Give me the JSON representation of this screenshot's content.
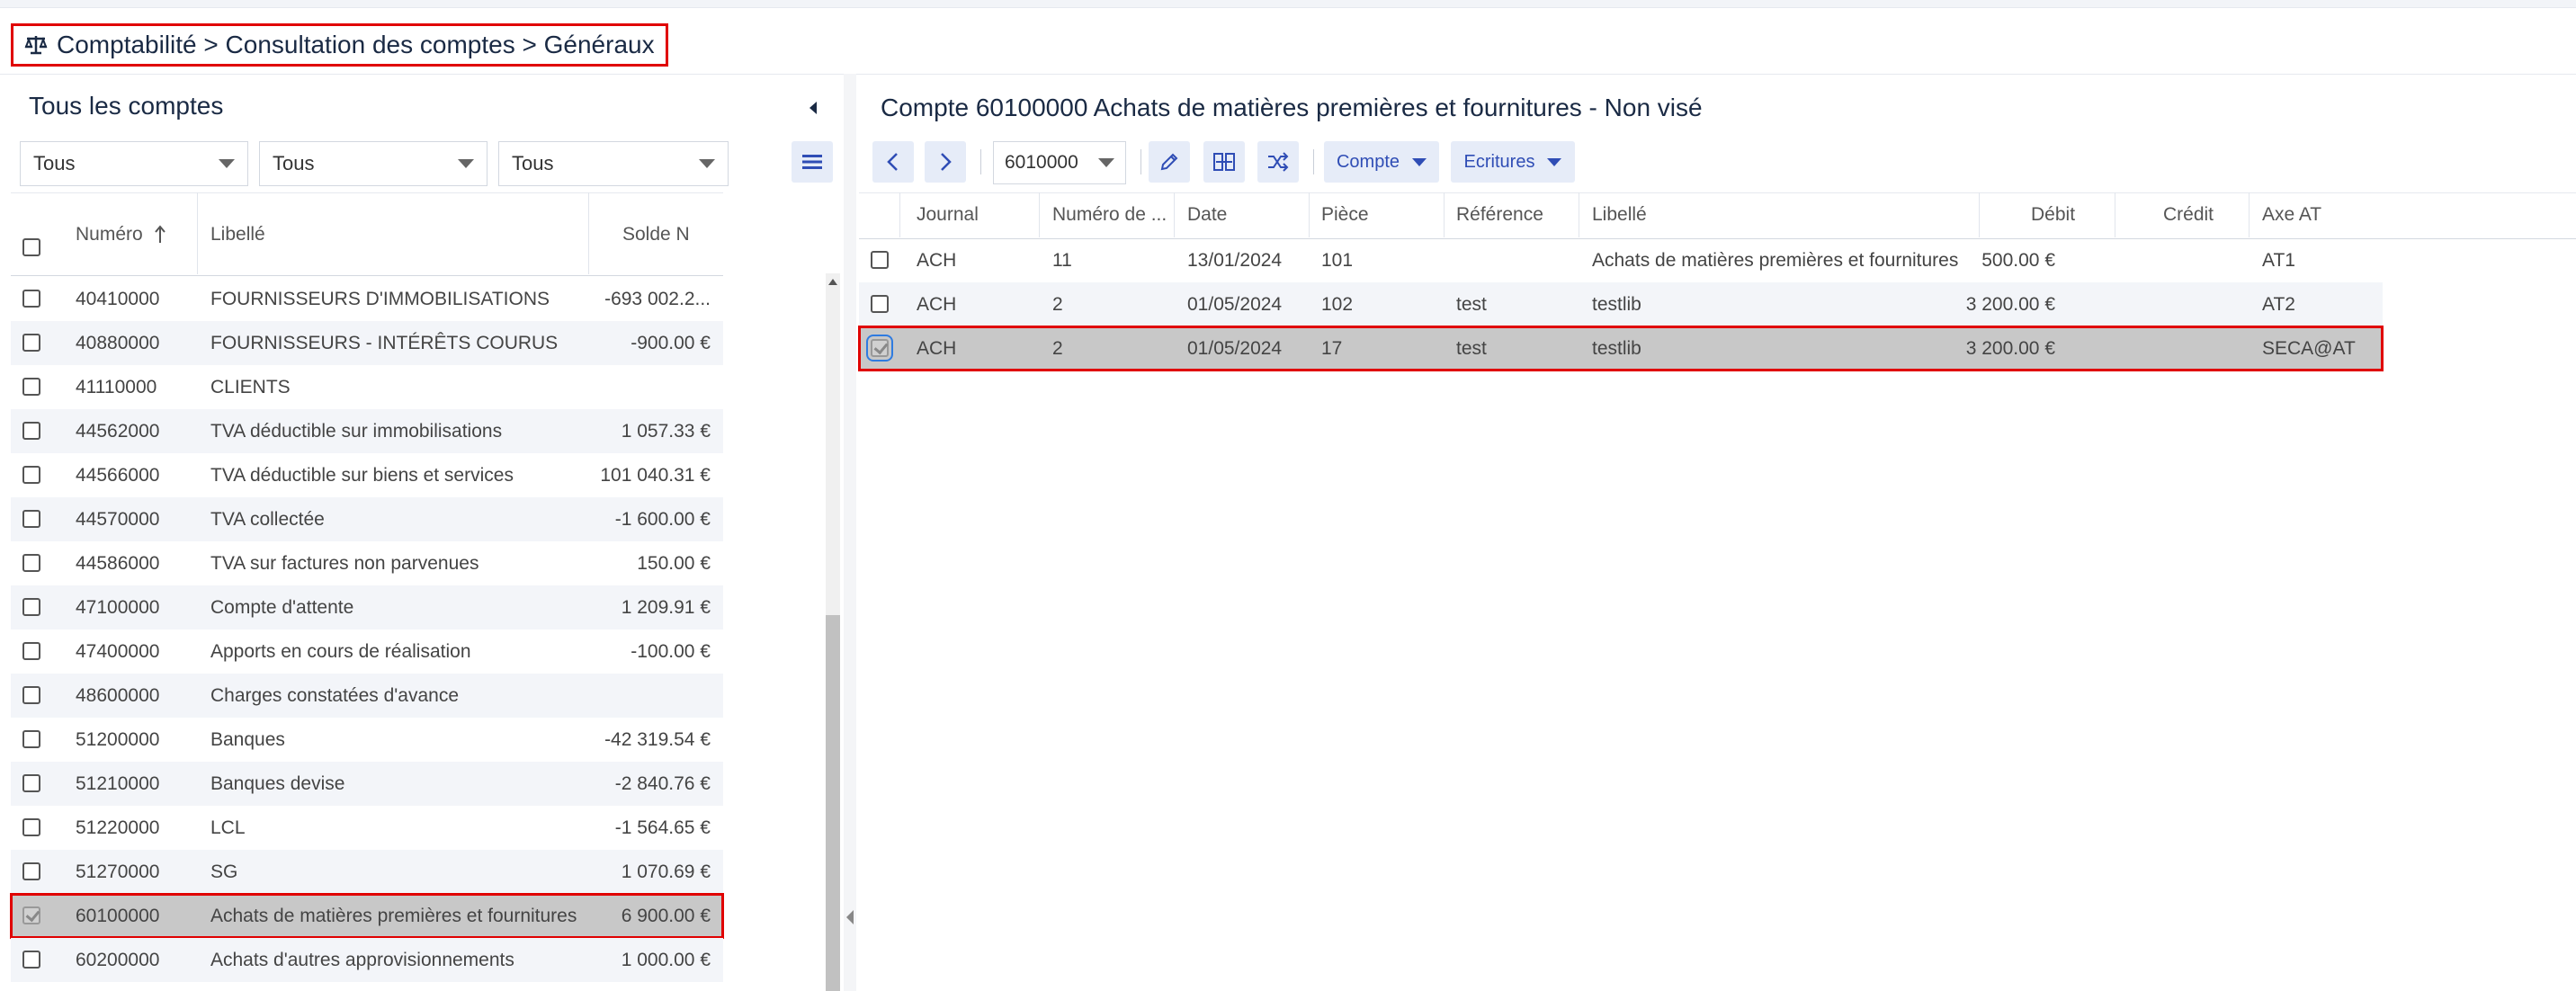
{
  "breadcrumb": "Comptabilité > Consultation des comptes > Généraux",
  "left": {
    "title": "Tous les comptes",
    "filters": [
      "Tous",
      "Tous",
      "Tous"
    ],
    "columns": {
      "numero": "Numéro",
      "libelle": "Libellé",
      "solde": "Solde N"
    },
    "rows": [
      {
        "num": "40410000",
        "lib": "FOURNISSEURS D'IMMOBILISATIONS",
        "solde": "-693 002.2..."
      },
      {
        "num": "40880000",
        "lib": "FOURNISSEURS - INTÉRÊTS COURUS",
        "solde": "-900.00 €"
      },
      {
        "num": "41110000",
        "lib": "CLIENTS",
        "solde": ""
      },
      {
        "num": "44562000",
        "lib": "TVA déductible sur immobilisations",
        "solde": "1 057.33 €"
      },
      {
        "num": "44566000",
        "lib": "TVA déductible sur biens et services",
        "solde": "101 040.31 €"
      },
      {
        "num": "44570000",
        "lib": "TVA collectée",
        "solde": "-1 600.00 €"
      },
      {
        "num": "44586000",
        "lib": "TVA sur factures non parvenues",
        "solde": "150.00 €"
      },
      {
        "num": "47100000",
        "lib": "Compte d'attente",
        "solde": "1 209.91 €"
      },
      {
        "num": "47400000",
        "lib": "Apports en cours de réalisation",
        "solde": "-100.00 €"
      },
      {
        "num": "48600000",
        "lib": "Charges constatées d'avance",
        "solde": ""
      },
      {
        "num": "51200000",
        "lib": "Banques",
        "solde": "-42 319.54 €"
      },
      {
        "num": "51210000",
        "lib": "Banques devise",
        "solde": "-2 840.76 €"
      },
      {
        "num": "51220000",
        "lib": "LCL",
        "solde": "-1 564.65 €"
      },
      {
        "num": "51270000",
        "lib": "SG",
        "solde": "1 070.69 €"
      },
      {
        "num": "60100000",
        "lib": "Achats de matières premières et fournitures",
        "solde": "6 900.00 €"
      },
      {
        "num": "60200000",
        "lib": "Achats d'autres approvisionnements",
        "solde": "1 000.00 €"
      }
    ]
  },
  "right": {
    "title": "Compte 60100000 Achats de matières premières et fournitures - Non visé",
    "account_select": "6010000",
    "compte_label": "Compte",
    "ecritures_label": "Ecritures",
    "columns": [
      "Journal",
      "Numéro de ...",
      "Date",
      "Pièce",
      "Référence",
      "Libellé",
      "Débit",
      "Crédit",
      "Axe AT"
    ],
    "rows": [
      {
        "journal": "ACH",
        "numero": "11",
        "date": "13/01/2024",
        "piece": "101",
        "ref": "",
        "lib": "Achats de matières premières et fournitures",
        "debit": "500.00 €",
        "credit": "",
        "axe": "AT1"
      },
      {
        "journal": "ACH",
        "numero": "2",
        "date": "01/05/2024",
        "piece": "102",
        "ref": "test",
        "lib": "testlib",
        "debit": "3 200.00 €",
        "credit": "",
        "axe": "AT2"
      },
      {
        "journal": "ACH",
        "numero": "2",
        "date": "01/05/2024",
        "piece": "17",
        "ref": "test",
        "lib": "testlib",
        "debit": "3 200.00 €",
        "credit": "",
        "axe": "SECA@AT"
      }
    ]
  },
  "colors": {
    "accent": "#2f4db5",
    "highlight_border": "#e00000",
    "selected_row": "#c8c8c8"
  }
}
